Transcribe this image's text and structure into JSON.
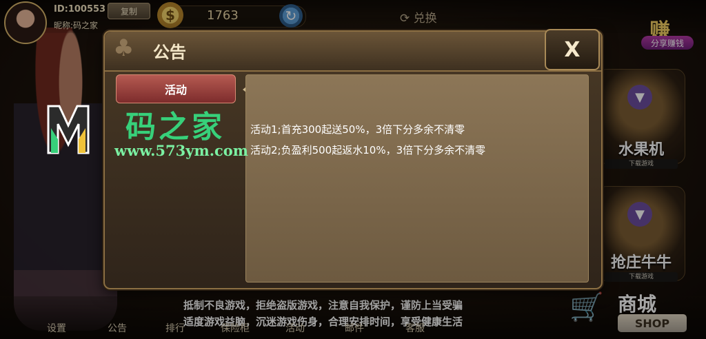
{
  "header": {
    "user_id": "ID:100553",
    "nickname": "昵称:码之家",
    "copy_label": "复制",
    "coins": "1763",
    "exchange_label": "兑换",
    "share_big": "赚",
    "share_label": "分享赚钱"
  },
  "modal": {
    "title": "公告",
    "close_label": "X",
    "tabs": [
      {
        "label": "活动",
        "active": true
      }
    ],
    "content_lines": [
      "活动1;首充300起送50%，3倍下分多余不清零",
      "活动2;负盈利500起返水10%，3倍下分多余不清零"
    ]
  },
  "games": [
    {
      "name": "水果机",
      "sub": "下载游戏"
    },
    {
      "name": "抢庄牛牛",
      "sub": "下载游戏"
    }
  ],
  "notice": [
    "抵制不良游戏，拒绝盗版游戏，注意自我保护，谨防上当受骗",
    "适度游戏益脑，沉迷游戏伤身，合理安排时间，享受健康生活"
  ],
  "nav": [
    "设置",
    "公告",
    "排行",
    "保险柜",
    "活动",
    "邮件",
    "客服"
  ],
  "shop": {
    "cn": "商城",
    "en": "SHOP"
  },
  "watermark": {
    "title": "码之家",
    "url": "www.573ym.com"
  }
}
